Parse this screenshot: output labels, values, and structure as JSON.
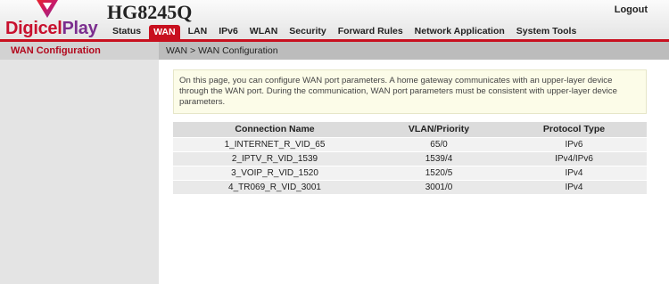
{
  "header": {
    "brand_part1": "Digicel",
    "brand_part2": "Play",
    "model": "HG8245Q",
    "logout_label": "Logout"
  },
  "nav": {
    "items": [
      {
        "label": "Status",
        "active": false
      },
      {
        "label": "WAN",
        "active": true
      },
      {
        "label": "LAN",
        "active": false
      },
      {
        "label": "IPv6",
        "active": false
      },
      {
        "label": "WLAN",
        "active": false
      },
      {
        "label": "Security",
        "active": false
      },
      {
        "label": "Forward Rules",
        "active": false
      },
      {
        "label": "Network Application",
        "active": false
      },
      {
        "label": "System Tools",
        "active": false
      }
    ]
  },
  "sidebar": {
    "items": [
      {
        "label": "WAN Configuration",
        "selected": true
      }
    ]
  },
  "main": {
    "breadcrumb": "WAN > WAN Configuration",
    "info_text": "On this page, you can configure WAN port parameters. A home gateway communicates with an upper-layer device through the WAN port. During the communication, WAN port parameters must be consistent with upper-layer device parameters.",
    "table": {
      "headers": [
        "Connection Name",
        "VLAN/Priority",
        "Protocol Type"
      ],
      "rows": [
        [
          "1_INTERNET_R_VID_65",
          "65/0",
          "IPv6"
        ],
        [
          "2_IPTV_R_VID_1539",
          "1539/4",
          "IPv4/IPv6"
        ],
        [
          "3_VOIP_R_VID_1520",
          "1520/5",
          "IPv4"
        ],
        [
          "4_TR069_R_VID_3001",
          "3001/0",
          "IPv4"
        ]
      ]
    }
  },
  "colors": {
    "accent_red": "#c8101f",
    "brand_purple": "#7b2d8e",
    "sidebar_bg": "#e4e4e4",
    "info_bg": "#fcfce8"
  }
}
